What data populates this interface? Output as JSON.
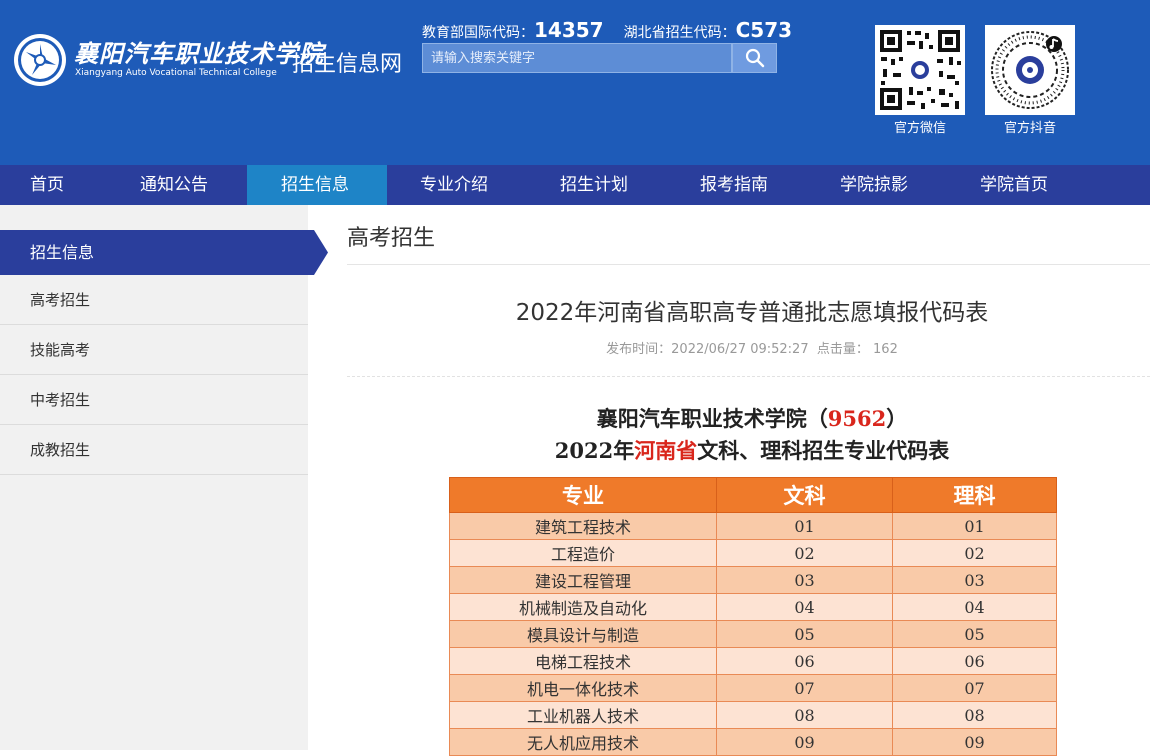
{
  "header": {
    "school_name_cn": "襄阳汽车职业技术学院",
    "school_name_en": "Xiangyang Auto Vocational Technical College",
    "site_name": "招生信息网",
    "moe_code_label": "教育部国际代码：",
    "moe_code": "14357",
    "hubei_code_label": "湖北省招生代码：",
    "hubei_code": "C573",
    "search_placeholder": "请输入搜索关键字",
    "qr_wechat_label": "官方微信",
    "qr_douyin_label": "官方抖音",
    "brand_color": "#1e5bb8"
  },
  "nav": {
    "items": [
      "首页",
      "通知公告",
      "招生信息",
      "专业介绍",
      "招生计划",
      "报考指南",
      "学院掠影",
      "学院首页"
    ],
    "active": "招生信息"
  },
  "sidebar": {
    "heading": "招生信息",
    "items": [
      "高考招生",
      "技能高考",
      "中考招生",
      "成教招生"
    ]
  },
  "main": {
    "section_title": "高考招生",
    "article_title": "2022年河南省高职高专普通批志愿填报代码表",
    "meta_publish_label": "发布时间：",
    "meta_publish_time": "2022/06/27 09:52:27",
    "meta_clicks_label": "点击量：",
    "meta_clicks": "162",
    "sub_school": "襄阳汽车职业技术学院（",
    "sub_school_code": "9562",
    "sub_school_close": "）",
    "sub_year": "2022年",
    "sub_province": "河南省",
    "sub_rest": "文科、理科招生专业代码表",
    "table": {
      "headers": [
        "专业",
        "文科",
        "理科"
      ],
      "rows": [
        [
          "建筑工程技术",
          "01",
          "01"
        ],
        [
          "工程造价",
          "02",
          "02"
        ],
        [
          "建设工程管理",
          "03",
          "03"
        ],
        [
          "机械制造及自动化",
          "04",
          "04"
        ],
        [
          "模具设计与制造",
          "05",
          "05"
        ],
        [
          "电梯工程技术",
          "06",
          "06"
        ],
        [
          "机电一体化技术",
          "07",
          "07"
        ],
        [
          "工业机器人技术",
          "08",
          "08"
        ],
        [
          "无人机应用技术",
          "09",
          "09"
        ]
      ]
    }
  }
}
